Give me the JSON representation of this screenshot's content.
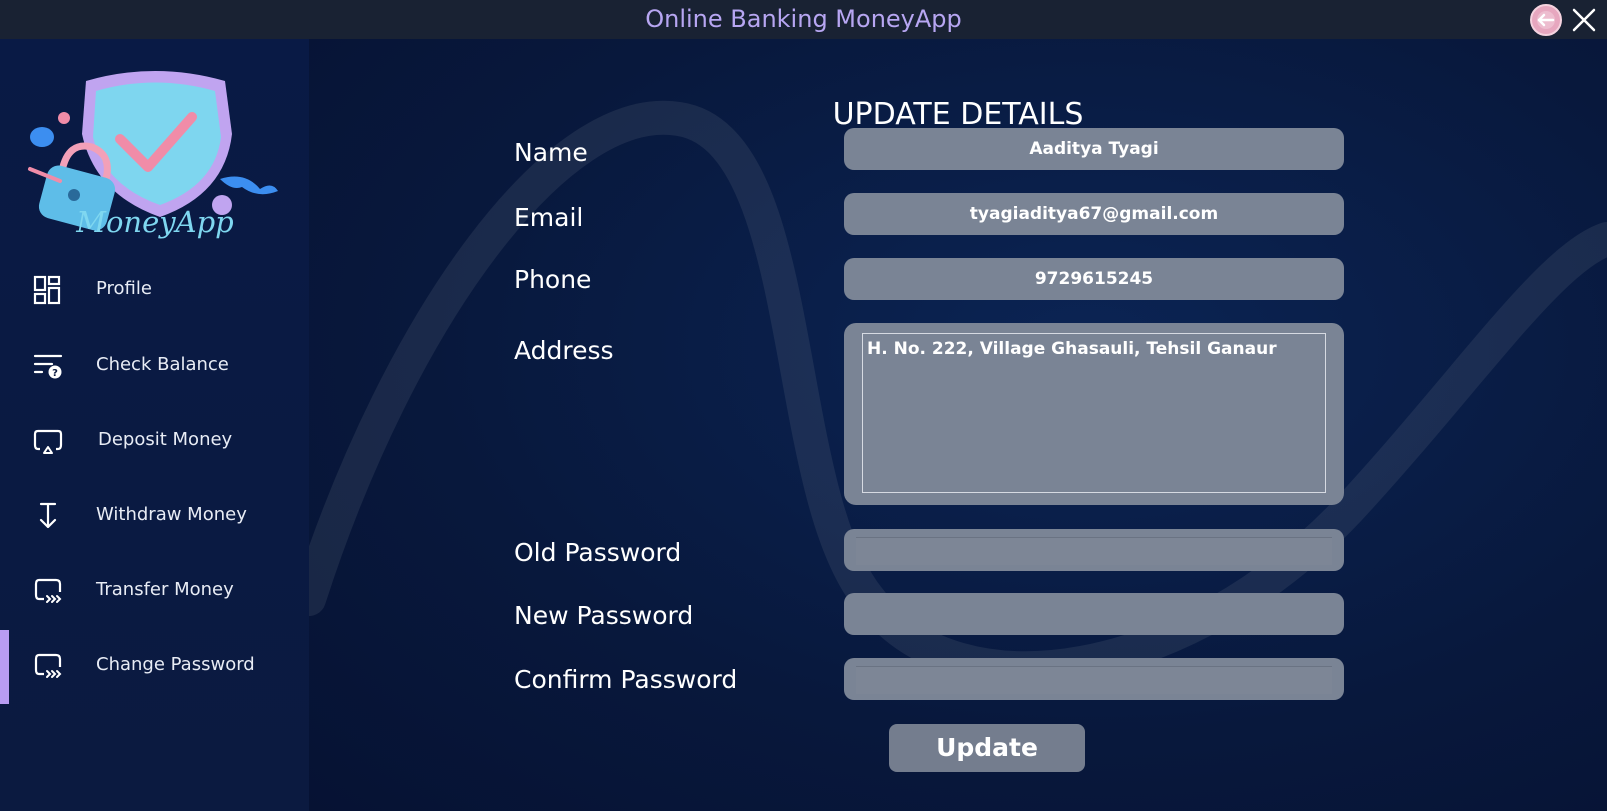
{
  "window": {
    "title": "Online Banking MoneyApp"
  },
  "sidebar": {
    "logo_text": "MoneyApp",
    "items": [
      {
        "label": "Profile",
        "icon": "dashboard-icon"
      },
      {
        "label": "Check Balance",
        "icon": "balance-list-icon"
      },
      {
        "label": "Deposit Money",
        "icon": "deposit-icon"
      },
      {
        "label": "Withdraw Money",
        "icon": "withdraw-arrow-icon"
      },
      {
        "label": "Transfer Money",
        "icon": "transfer-icon"
      },
      {
        "label": "Change Password",
        "icon": "transfer-icon",
        "active": true
      }
    ]
  },
  "main": {
    "heading": "UPDATE DETAILS",
    "fields": {
      "name": {
        "label": "Name",
        "value": "Aaditya Tyagi"
      },
      "email": {
        "label": "Email",
        "value": "tyagiaditya67@gmail.com"
      },
      "phone": {
        "label": "Phone",
        "value": "9729615245"
      },
      "address": {
        "label": "Address",
        "value": "H. No. 222, Village Ghasauli, Tehsil Ganaur"
      },
      "old_password": {
        "label": "Old Password",
        "value": ""
      },
      "new_password": {
        "label": "New Password",
        "value": ""
      },
      "confirm_password": {
        "label": "Confirm Password",
        "value": ""
      }
    },
    "update_button": "Update"
  },
  "colors": {
    "accent": "#b89cf2",
    "sidebar_bg": "#091a45",
    "main_bg": "#08183c",
    "field_bg": "#7a8495",
    "title_text": "#b7a6f2"
  }
}
